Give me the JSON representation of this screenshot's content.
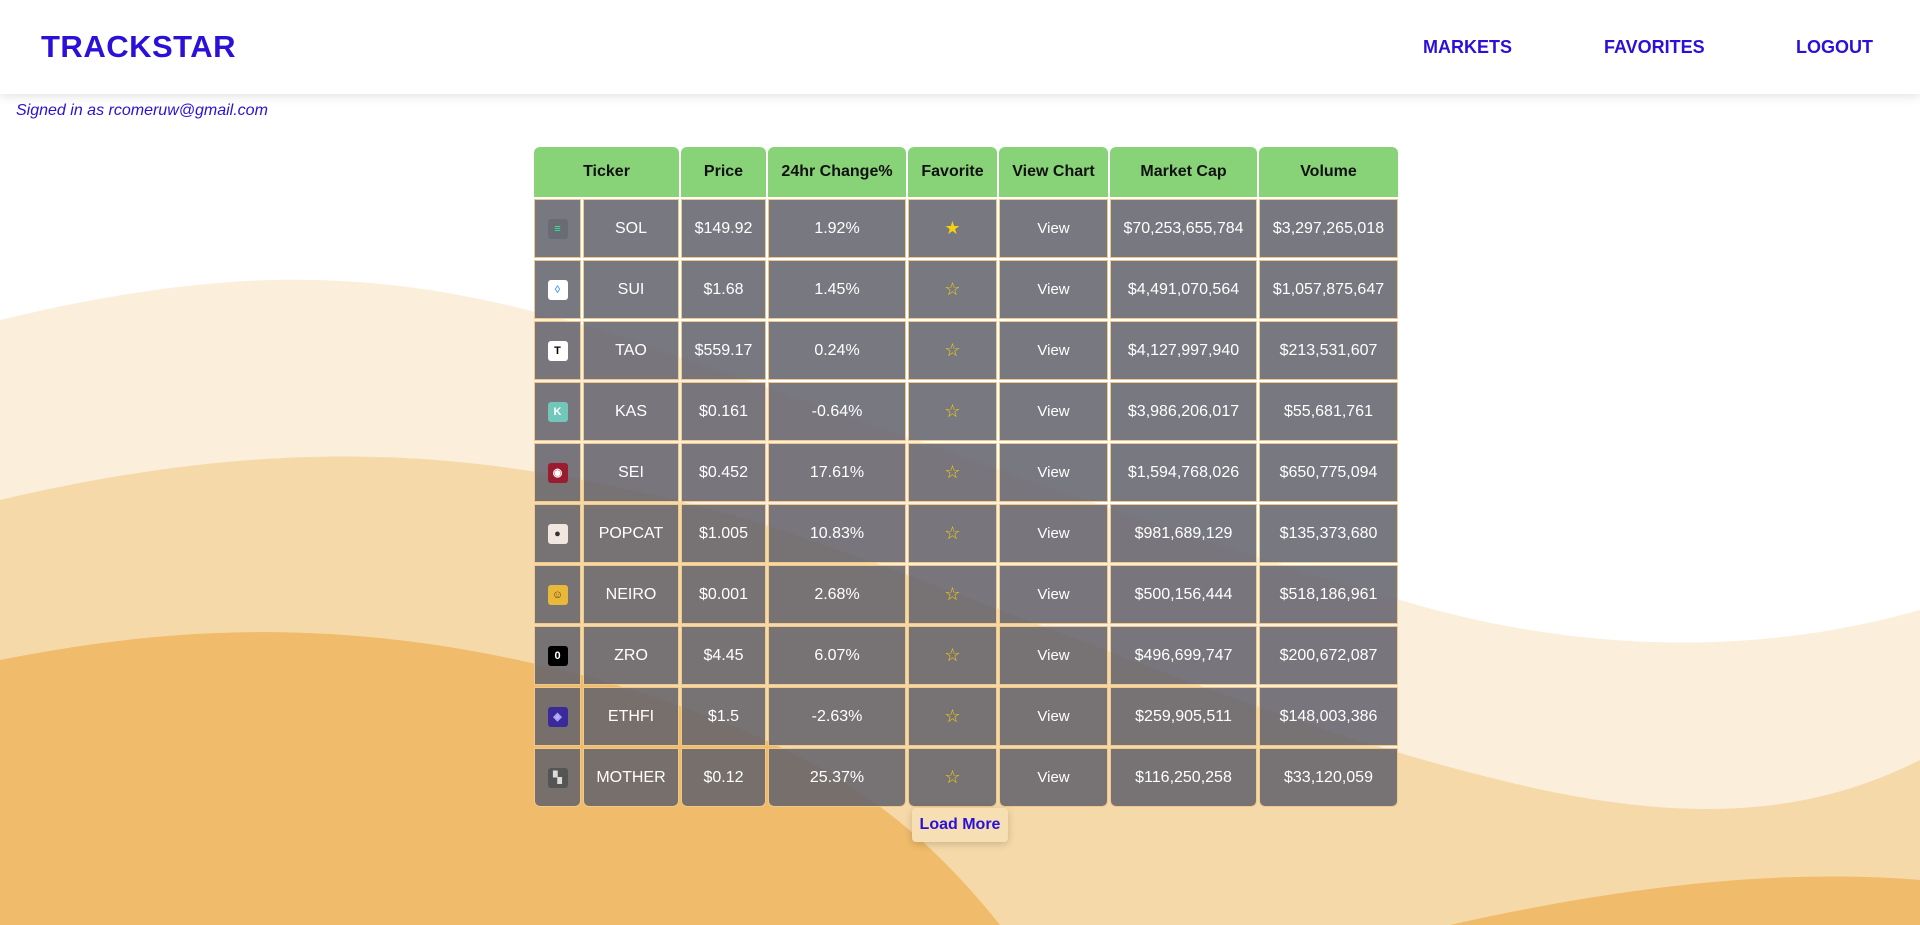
{
  "app": {
    "brand": "TRACKSTAR"
  },
  "nav": {
    "markets": "MARKETS",
    "favorites": "FAVORITES",
    "logout": "LOGOUT"
  },
  "user": {
    "signed_in_text": "Signed in as rcomeruw@gmail.com"
  },
  "table": {
    "headers": [
      "Ticker",
      "Price",
      "24hr Change%",
      "Favorite",
      "View Chart",
      "Market Cap",
      "Volume"
    ],
    "view_label": "View",
    "rows": [
      {
        "icon": "sol-logo-icon",
        "icon_bg": "#6b6b76",
        "icon_fg": "#19fb9b",
        "icon_glyph": "≡",
        "ticker": "SOL",
        "price": "$149.92",
        "change": "1.92%",
        "favorite": true,
        "market_cap": "$70,253,655,784",
        "volume": "$3,297,265,018"
      },
      {
        "icon": "sui-logo-icon",
        "icon_bg": "#ffffff",
        "icon_fg": "#4da2ff",
        "icon_glyph": "◊",
        "ticker": "SUI",
        "price": "$1.68",
        "change": "1.45%",
        "favorite": false,
        "market_cap": "$4,491,070,564",
        "volume": "$1,057,875,647"
      },
      {
        "icon": "tao-logo-icon",
        "icon_bg": "#ffffff",
        "icon_fg": "#000000",
        "icon_glyph": "T",
        "ticker": "TAO",
        "price": "$559.17",
        "change": "0.24%",
        "favorite": false,
        "market_cap": "$4,127,997,940",
        "volume": "$213,531,607"
      },
      {
        "icon": "kas-logo-icon",
        "icon_bg": "#70c7ba",
        "icon_fg": "#ffffff",
        "icon_glyph": "K",
        "ticker": "KAS",
        "price": "$0.161",
        "change": "-0.64%",
        "favorite": false,
        "market_cap": "$3,986,206,017",
        "volume": "$55,681,761"
      },
      {
        "icon": "sei-logo-icon",
        "icon_bg": "#9b1c2e",
        "icon_fg": "#ffffff",
        "icon_glyph": "◉",
        "ticker": "SEI",
        "price": "$0.452",
        "change": "17.61%",
        "favorite": false,
        "market_cap": "$1,594,768,026",
        "volume": "$650,775,094"
      },
      {
        "icon": "popcat-logo-icon",
        "icon_bg": "#f2e6e0",
        "icon_fg": "#333333",
        "icon_glyph": "●",
        "ticker": "POPCAT",
        "price": "$1.005",
        "change": "10.83%",
        "favorite": false,
        "market_cap": "$981,689,129",
        "volume": "$135,373,680"
      },
      {
        "icon": "neiro-logo-icon",
        "icon_bg": "#e9b83a",
        "icon_fg": "#5a3a10",
        "icon_glyph": "☺",
        "ticker": "NEIRO",
        "price": "$0.001",
        "change": "2.68%",
        "favorite": false,
        "market_cap": "$500,156,444",
        "volume": "$518,186,961"
      },
      {
        "icon": "zro-logo-icon",
        "icon_bg": "#000000",
        "icon_fg": "#ffffff",
        "icon_glyph": "0",
        "ticker": "ZRO",
        "price": "$4.45",
        "change": "6.07%",
        "favorite": false,
        "market_cap": "$496,699,747",
        "volume": "$200,672,087"
      },
      {
        "icon": "ethfi-logo-icon",
        "icon_bg": "#3a2a9a",
        "icon_fg": "#b9b2ff",
        "icon_glyph": "◈",
        "ticker": "ETHFI",
        "price": "$1.5",
        "change": "-2.63%",
        "favorite": false,
        "market_cap": "$259,905,511",
        "volume": "$148,003,386"
      },
      {
        "icon": "mother-logo-icon",
        "icon_bg": "#555555",
        "icon_fg": "#dddddd",
        "icon_glyph": "▚",
        "ticker": "MOTHER",
        "price": "$0.12",
        "change": "25.37%",
        "favorite": false,
        "market_cap": "$116,250,258",
        "volume": "$33,120,059"
      }
    ]
  },
  "actions": {
    "load_more": "Load More"
  },
  "colors": {
    "brand": "#2a10d8",
    "header_row": "#88d378",
    "row_bg": "#62626c",
    "star": "#f5d10f",
    "wave_light": "#fbeedb",
    "wave_mid": "#f6d9a8",
    "wave_dark": "#f0ba68"
  }
}
